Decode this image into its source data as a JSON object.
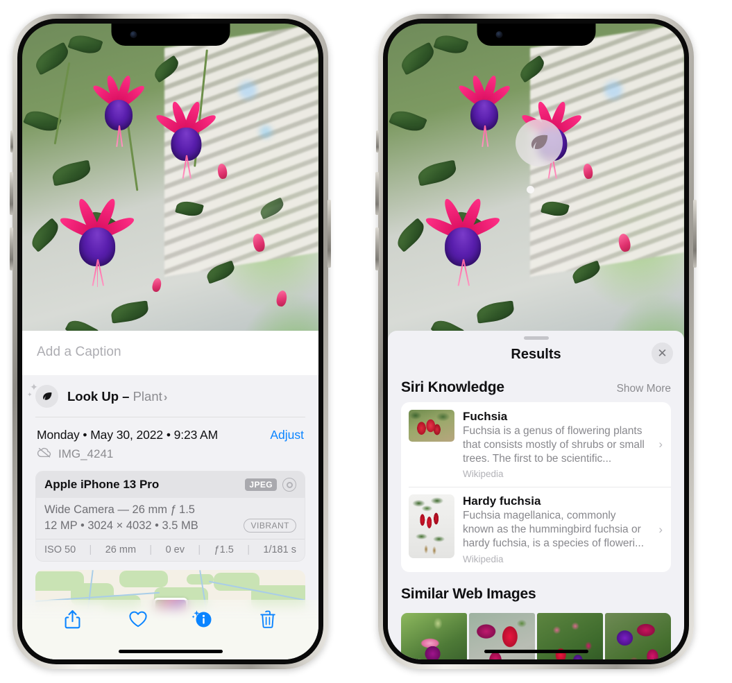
{
  "left_phone": {
    "name": "photos-detail-view",
    "caption": {
      "placeholder": "Add a Caption",
      "value": ""
    },
    "lookup": {
      "icon": "leaf-icon",
      "label": "Look Up",
      "dash": "–",
      "kind": "Plant",
      "chevron": "›"
    },
    "date_row": {
      "date": "Monday • May 30, 2022 • 9:23 AM",
      "adjust_label": "Adjust"
    },
    "file_row": {
      "icon": "cloud-slash-icon",
      "filename": "IMG_4241"
    },
    "camera_card": {
      "model": "Apple iPhone 13 Pro",
      "format_badge": "JPEG",
      "aperture_icon": "aperture-icon",
      "lens_line": "Wide Camera — 26 mm ƒ 1.5",
      "size_line": "12 MP • 3024 × 4032 • 3.5 MB",
      "style_badge": "VIBRANT",
      "exif": [
        {
          "label": "ISO 50"
        },
        {
          "label": "26 mm"
        },
        {
          "label": "0 ev"
        },
        {
          "label": "ƒ1.5"
        },
        {
          "label": "1/181 s"
        }
      ],
      "exif_separator": "|"
    },
    "map": {
      "name": "location-map-preview",
      "pin": "photo-pin"
    },
    "toolbar": [
      {
        "name": "share-button",
        "icon": "share-icon"
      },
      {
        "name": "favorite-button",
        "icon": "heart-icon"
      },
      {
        "name": "info-button",
        "icon": "info-sparkle-icon"
      },
      {
        "name": "delete-button",
        "icon": "trash-icon"
      }
    ]
  },
  "right_phone": {
    "name": "visual-lookup-results-view",
    "badge": {
      "name": "visual-lookup-badge",
      "icon": "leaf-icon"
    },
    "sheet": {
      "title": "Results",
      "close_icon": "close-icon",
      "sections": [
        {
          "title": "Siri Knowledge",
          "action": "Show More",
          "items": [
            {
              "title": "Fuchsia",
              "description": "Fuchsia is a genus of flowering plants that consists mostly of shrubs or small trees. The first to be scientific...",
              "source": "Wikipedia",
              "chevron": "›"
            },
            {
              "title": "Hardy fuchsia",
              "description": "Fuchsia magellanica, commonly known as the hummingbird fuchsia or hardy fuchsia, is a species of floweri...",
              "source": "Wikipedia",
              "chevron": "›"
            }
          ]
        },
        {
          "title": "Similar Web Images",
          "images": [
            {
              "name": "web-image-1"
            },
            {
              "name": "web-image-2"
            },
            {
              "name": "web-image-3"
            },
            {
              "name": "web-image-4"
            }
          ]
        }
      ]
    }
  },
  "colors": {
    "accent_blue": "#0a84ff",
    "sheet_bg": "#f1f1f5",
    "card_bg": "#ffffff",
    "secondary_text": "#8c8c90",
    "primary_text": "#101012"
  }
}
